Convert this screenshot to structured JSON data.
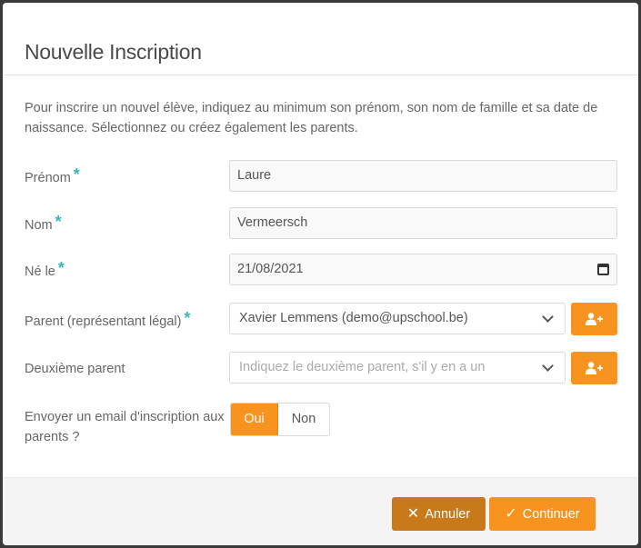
{
  "modal": {
    "title": "Nouvelle Inscription",
    "intro": "Pour inscrire un nouvel élève, indiquez au minimum son prénom, son nom de famille et sa date de naissance. Sélectionnez ou créez également les parents."
  },
  "fields": {
    "prenom": {
      "label": "Prénom",
      "required": "*",
      "value": "Laure"
    },
    "nom": {
      "label": "Nom",
      "required": "*",
      "value": "Vermeersch"
    },
    "ne_le": {
      "label": "Né le",
      "required": "*",
      "value": "21/08/2021"
    },
    "parent": {
      "label": "Parent (représentant légal)",
      "required": "*",
      "value": "Xavier Lemmens (demo@upschool.be)"
    },
    "parent2": {
      "label": "Deuxième parent",
      "placeholder": "Indiquez le deuxième parent, s'il y en a un"
    },
    "email": {
      "label": "Envoyer un email d'inscription aux parents ?",
      "yes": "Oui",
      "no": "Non",
      "selected": "Oui"
    }
  },
  "footer": {
    "cancel_icon": "✕",
    "cancel_label": "Annuler",
    "continue_icon": "✓",
    "continue_label": "Continuer"
  },
  "colors": {
    "accent": "#f7931e",
    "accent_dark": "#c8791a",
    "required": "#3ab8b8"
  },
  "icons": {
    "add_parent": "user-plus-icon",
    "date": "calendar-icon",
    "dropdown": "chevron-down-icon"
  }
}
